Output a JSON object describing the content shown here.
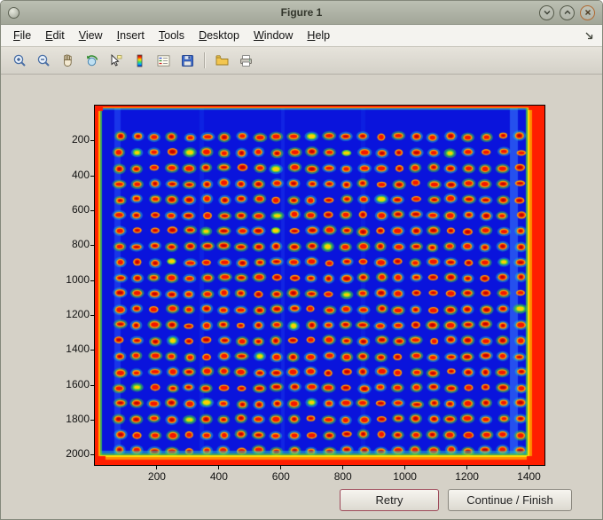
{
  "window": {
    "title": "Figure 1"
  },
  "menu": {
    "items": [
      {
        "label": "File"
      },
      {
        "label": "Edit"
      },
      {
        "label": "View"
      },
      {
        "label": "Insert"
      },
      {
        "label": "Tools"
      },
      {
        "label": "Desktop"
      },
      {
        "label": "Window"
      },
      {
        "label": "Help"
      }
    ]
  },
  "toolbar": {
    "icons": [
      "zoom-in",
      "zoom-out",
      "pan-hand",
      "rotate-3d",
      "data-cursor",
      "insert-colorbar",
      "insert-legend",
      "save",
      "open-folder",
      "print"
    ]
  },
  "plot": {
    "type": "image-heatmap",
    "colormap": "jet",
    "description": "Microarray scan: grid of red/orange spots on blue background with saturated red borders",
    "x_ticks": [
      200,
      400,
      600,
      800,
      1000,
      1200,
      1400
    ],
    "y_ticks": [
      200,
      400,
      600,
      800,
      1000,
      1200,
      1400,
      1600,
      1800,
      2000
    ],
    "x_range": [
      0,
      1450
    ],
    "y_range": [
      0,
      2060
    ],
    "grid": {
      "rows": 21,
      "cols": 24,
      "x_start": 80,
      "x_step": 56.2,
      "y_start": 178,
      "y_step": 90
    },
    "colors": {
      "figure_bg": "#d5d1c7",
      "field_blue": "#0a14dc",
      "edge_red": "#ff1e00",
      "spot_ring": "#ffa000",
      "spot_center": "#f31400"
    }
  },
  "buttons": {
    "retry": "Retry",
    "continue": "Continue / Finish"
  }
}
